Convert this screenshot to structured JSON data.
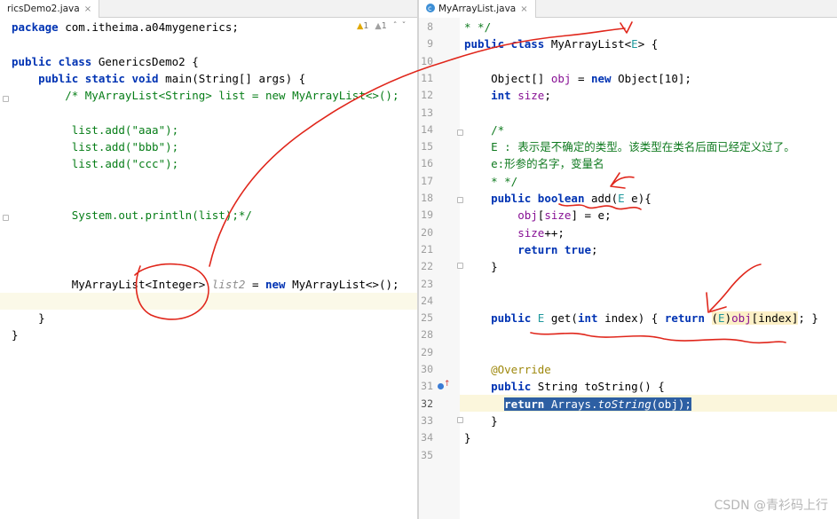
{
  "left_editor": {
    "tab_label": "ricsDemo2.java",
    "tab_close": "×",
    "warnings": {
      "warn1": "1",
      "warn2": "1",
      "arrow_up": "ˆ",
      "arrow_down": "ˇ"
    },
    "lines": [
      {
        "id": "l1",
        "segments": [
          {
            "c": "kw",
            "t": "package "
          },
          {
            "c": "cls",
            "t": "com.itheima.a04mygenerics;"
          }
        ]
      },
      {
        "id": "l2",
        "segments": []
      },
      {
        "id": "l3",
        "segments": [
          {
            "c": "kw",
            "t": "public class "
          },
          {
            "c": "cls",
            "t": "GenericsDemo2 {"
          }
        ]
      },
      {
        "id": "l4",
        "segments": [
          {
            "c": "cls",
            "t": "    "
          },
          {
            "c": "kw",
            "t": "public static void "
          },
          {
            "c": "cls",
            "t": "main(String[] args) {"
          }
        ]
      },
      {
        "id": "l5",
        "segments": [
          {
            "c": "cm-green",
            "t": "        /* MyArrayList<String> list = new MyArrayList<>();"
          }
        ]
      },
      {
        "id": "l6",
        "segments": []
      },
      {
        "id": "l7",
        "segments": [
          {
            "c": "cm-green",
            "t": "         list.add(\"aaa\");"
          }
        ]
      },
      {
        "id": "l8",
        "segments": [
          {
            "c": "cm-green",
            "t": "         list.add(\"bbb\");"
          }
        ]
      },
      {
        "id": "l9",
        "segments": [
          {
            "c": "cm-green",
            "t": "         list.add(\"ccc\");"
          }
        ]
      },
      {
        "id": "l10",
        "segments": []
      },
      {
        "id": "l11",
        "segments": []
      },
      {
        "id": "l12",
        "segments": [
          {
            "c": "cm-green",
            "t": "         System.out.println(list);*/"
          }
        ]
      },
      {
        "id": "l13",
        "segments": []
      },
      {
        "id": "l14",
        "segments": []
      },
      {
        "id": "l15",
        "segments": []
      },
      {
        "id": "l16",
        "segments": [
          {
            "c": "cls",
            "t": "         MyArrayList<Integer> "
          },
          {
            "c": "cm",
            "t": "list2"
          },
          {
            "c": "cls",
            "t": " = "
          },
          {
            "c": "kw",
            "t": "new "
          },
          {
            "c": "cls",
            "t": "MyArrayList<>();"
          }
        ]
      },
      {
        "id": "l17",
        "segments": []
      },
      {
        "id": "l18",
        "segments": [
          {
            "c": "cls",
            "t": "    }"
          }
        ]
      },
      {
        "id": "l19",
        "segments": [
          {
            "c": "cls",
            "t": "}"
          }
        ]
      }
    ]
  },
  "right_editor": {
    "tab_label": "MyArrayList.java",
    "tab_close": "×",
    "lines": [
      {
        "n": "8",
        "segments": [
          {
            "c": "doc",
            "t": "* */"
          }
        ]
      },
      {
        "n": "9",
        "segments": [
          {
            "c": "kw",
            "t": "public class "
          },
          {
            "c": "cls",
            "t": "MyArrayList<"
          },
          {
            "c": "tp",
            "t": "E"
          },
          {
            "c": "cls",
            "t": "> {"
          }
        ]
      },
      {
        "n": "10",
        "segments": []
      },
      {
        "n": "11",
        "segments": [
          {
            "c": "cls",
            "t": "    Object[] "
          },
          {
            "c": "fld",
            "t": "obj"
          },
          {
            "c": "cls",
            "t": " = "
          },
          {
            "c": "kw",
            "t": "new "
          },
          {
            "c": "cls",
            "t": "Object[10];"
          }
        ]
      },
      {
        "n": "12",
        "segments": [
          {
            "c": "cls",
            "t": "    "
          },
          {
            "c": "kw",
            "t": "int "
          },
          {
            "c": "fld",
            "t": "size"
          },
          {
            "c": "cls",
            "t": ";"
          }
        ]
      },
      {
        "n": "13",
        "segments": []
      },
      {
        "n": "14",
        "segments": [
          {
            "c": "doc",
            "t": "    /*"
          }
        ]
      },
      {
        "n": "15",
        "segments": [
          {
            "c": "doc",
            "t": "    E : 表示是不确定的类型。该类型在类名后面已经定义过了。"
          }
        ]
      },
      {
        "n": "16",
        "segments": [
          {
            "c": "doc",
            "t": "    e:形参的名字，变量名"
          }
        ]
      },
      {
        "n": "17",
        "segments": [
          {
            "c": "doc",
            "t": "    * */"
          }
        ]
      },
      {
        "n": "18",
        "segments": [
          {
            "c": "cls",
            "t": "    "
          },
          {
            "c": "kw",
            "t": "public boolean "
          },
          {
            "c": "cls",
            "t": "add("
          },
          {
            "c": "tp",
            "t": "E"
          },
          {
            "c": "cls",
            "t": " e){"
          }
        ]
      },
      {
        "n": "19",
        "segments": [
          {
            "c": "cls",
            "t": "        "
          },
          {
            "c": "fld",
            "t": "obj"
          },
          {
            "c": "cls",
            "t": "["
          },
          {
            "c": "fld",
            "t": "size"
          },
          {
            "c": "cls",
            "t": "] = e;"
          }
        ]
      },
      {
        "n": "20",
        "segments": [
          {
            "c": "cls",
            "t": "        "
          },
          {
            "c": "fld",
            "t": "size"
          },
          {
            "c": "cls",
            "t": "++;"
          }
        ]
      },
      {
        "n": "21",
        "segments": [
          {
            "c": "cls",
            "t": "        "
          },
          {
            "c": "kw",
            "t": "return true"
          },
          {
            "c": "cls",
            "t": ";"
          }
        ]
      },
      {
        "n": "22",
        "segments": [
          {
            "c": "cls",
            "t": "    }"
          }
        ]
      },
      {
        "n": "23",
        "segments": []
      },
      {
        "n": "24",
        "segments": []
      },
      {
        "n": "25",
        "segments": [
          {
            "c": "cls",
            "t": "    "
          },
          {
            "c": "kw",
            "t": "public "
          },
          {
            "c": "tp",
            "t": "E"
          },
          {
            "c": "cls",
            "t": " get("
          },
          {
            "c": "kw",
            "t": "int "
          },
          {
            "c": "cls",
            "t": "index) { "
          },
          {
            "c": "kw",
            "t": "return "
          },
          {
            "c": "cls hl-cur",
            "t": "("
          },
          {
            "c": "tp hl-cur",
            "t": "E"
          },
          {
            "c": "cls hl-cur",
            "t": ")"
          },
          {
            "c": "fld hl-cur",
            "t": "obj"
          },
          {
            "c": "cls hl-cur",
            "t": "[index]"
          },
          {
            "c": "cls",
            "t": "; }"
          }
        ]
      },
      {
        "n": "28",
        "segments": []
      },
      {
        "n": "29",
        "segments": []
      },
      {
        "n": "30",
        "segments": [
          {
            "c": "ann",
            "t": "    @Override"
          }
        ]
      },
      {
        "n": "31",
        "segments": [
          {
            "c": "cls",
            "t": "    "
          },
          {
            "c": "kw",
            "t": "public "
          },
          {
            "c": "cls",
            "t": "String toString() {"
          }
        ]
      },
      {
        "n": "32",
        "segments": [
          {
            "c": "cls",
            "t": "      "
          },
          {
            "c": "kw hl-sel",
            "t": "return "
          },
          {
            "c": "cls hl-sel",
            "t": "Arrays."
          },
          {
            "c": "cls hl-sel ital",
            "t": "toString"
          },
          {
            "c": "cls hl-sel",
            "t": "("
          },
          {
            "c": "fld hl-sel",
            "t": "obj"
          },
          {
            "c": "cls hl-sel",
            "t": ");"
          }
        ]
      },
      {
        "n": "33",
        "segments": [
          {
            "c": "cls",
            "t": "    }"
          }
        ]
      },
      {
        "n": "34",
        "segments": [
          {
            "c": "cls",
            "t": "}"
          }
        ]
      },
      {
        "n": "35",
        "segments": []
      }
    ]
  },
  "watermark": "CSDN @青衫码上行"
}
